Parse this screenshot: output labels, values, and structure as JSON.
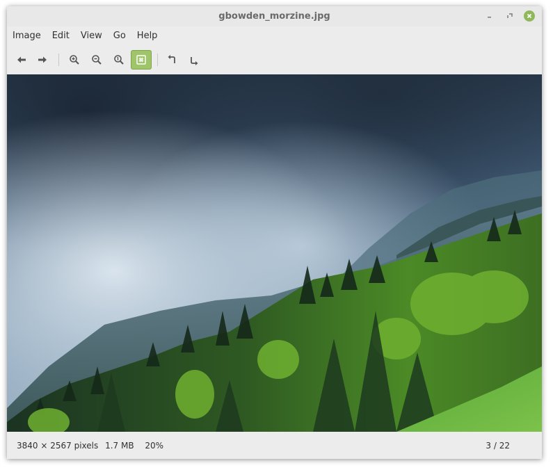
{
  "window": {
    "title": "gbowden_morzine.jpg",
    "controls": {
      "minimize_icon": "minimize-icon",
      "maximize_icon": "maximize-icon",
      "close_icon": "close-icon",
      "close_color": "#8fb85a"
    }
  },
  "menubar": {
    "items": [
      "Image",
      "Edit",
      "View",
      "Go",
      "Help"
    ]
  },
  "toolbar": {
    "buttons": [
      {
        "name": "back-button",
        "icon": "arrow-left-icon"
      },
      {
        "name": "forward-button",
        "icon": "arrow-right-icon"
      },
      {
        "name": "zoom-in-button",
        "icon": "zoom-in-icon"
      },
      {
        "name": "zoom-out-button",
        "icon": "zoom-out-icon"
      },
      {
        "name": "zoom-normal-button",
        "icon": "zoom-normal-icon"
      },
      {
        "name": "zoom-fit-button",
        "icon": "zoom-fit-icon",
        "active": true
      },
      {
        "name": "rotate-left-button",
        "icon": "rotate-left-icon"
      },
      {
        "name": "rotate-right-button",
        "icon": "rotate-right-icon"
      }
    ],
    "active_color": "#9fc46a"
  },
  "image": {
    "subject": "misty-forested-mountain-photo",
    "colors": {
      "sky": "#4d6a86",
      "fog": "#b8cad8",
      "forest_dark": "#1f3a22",
      "forest_light": "#6fb030",
      "meadow": "#63b23a"
    }
  },
  "statusbar": {
    "dimensions": "3840 × 2567 pixels",
    "size": "1.7 MB",
    "zoom": "20%",
    "position": "3 / 22"
  }
}
